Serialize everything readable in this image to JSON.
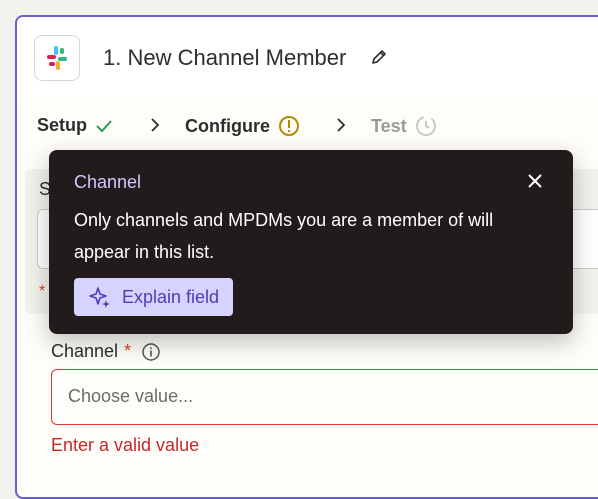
{
  "header": {
    "title": "1. New Channel Member"
  },
  "steps": [
    {
      "label": "Setup",
      "state": "complete"
    },
    {
      "label": "Configure",
      "state": "warning"
    },
    {
      "label": "Test",
      "state": "pending"
    }
  ],
  "background_field": {
    "label_fragment": "S",
    "asterisk": "*"
  },
  "channel_field": {
    "label": "Channel",
    "required_mark": "*",
    "placeholder": "Choose value...",
    "error": "Enter a valid value"
  },
  "tooltip": {
    "title": "Channel",
    "body": "Only channels and MPDMs you are a member of will appear in this list.",
    "button_label": "Explain field"
  },
  "colors": {
    "accent": "#6a5fcf",
    "error": "#c32a2a",
    "success": "#2e9d52",
    "warning": "#b58a00",
    "tooltip_bg": "#221b1c"
  }
}
